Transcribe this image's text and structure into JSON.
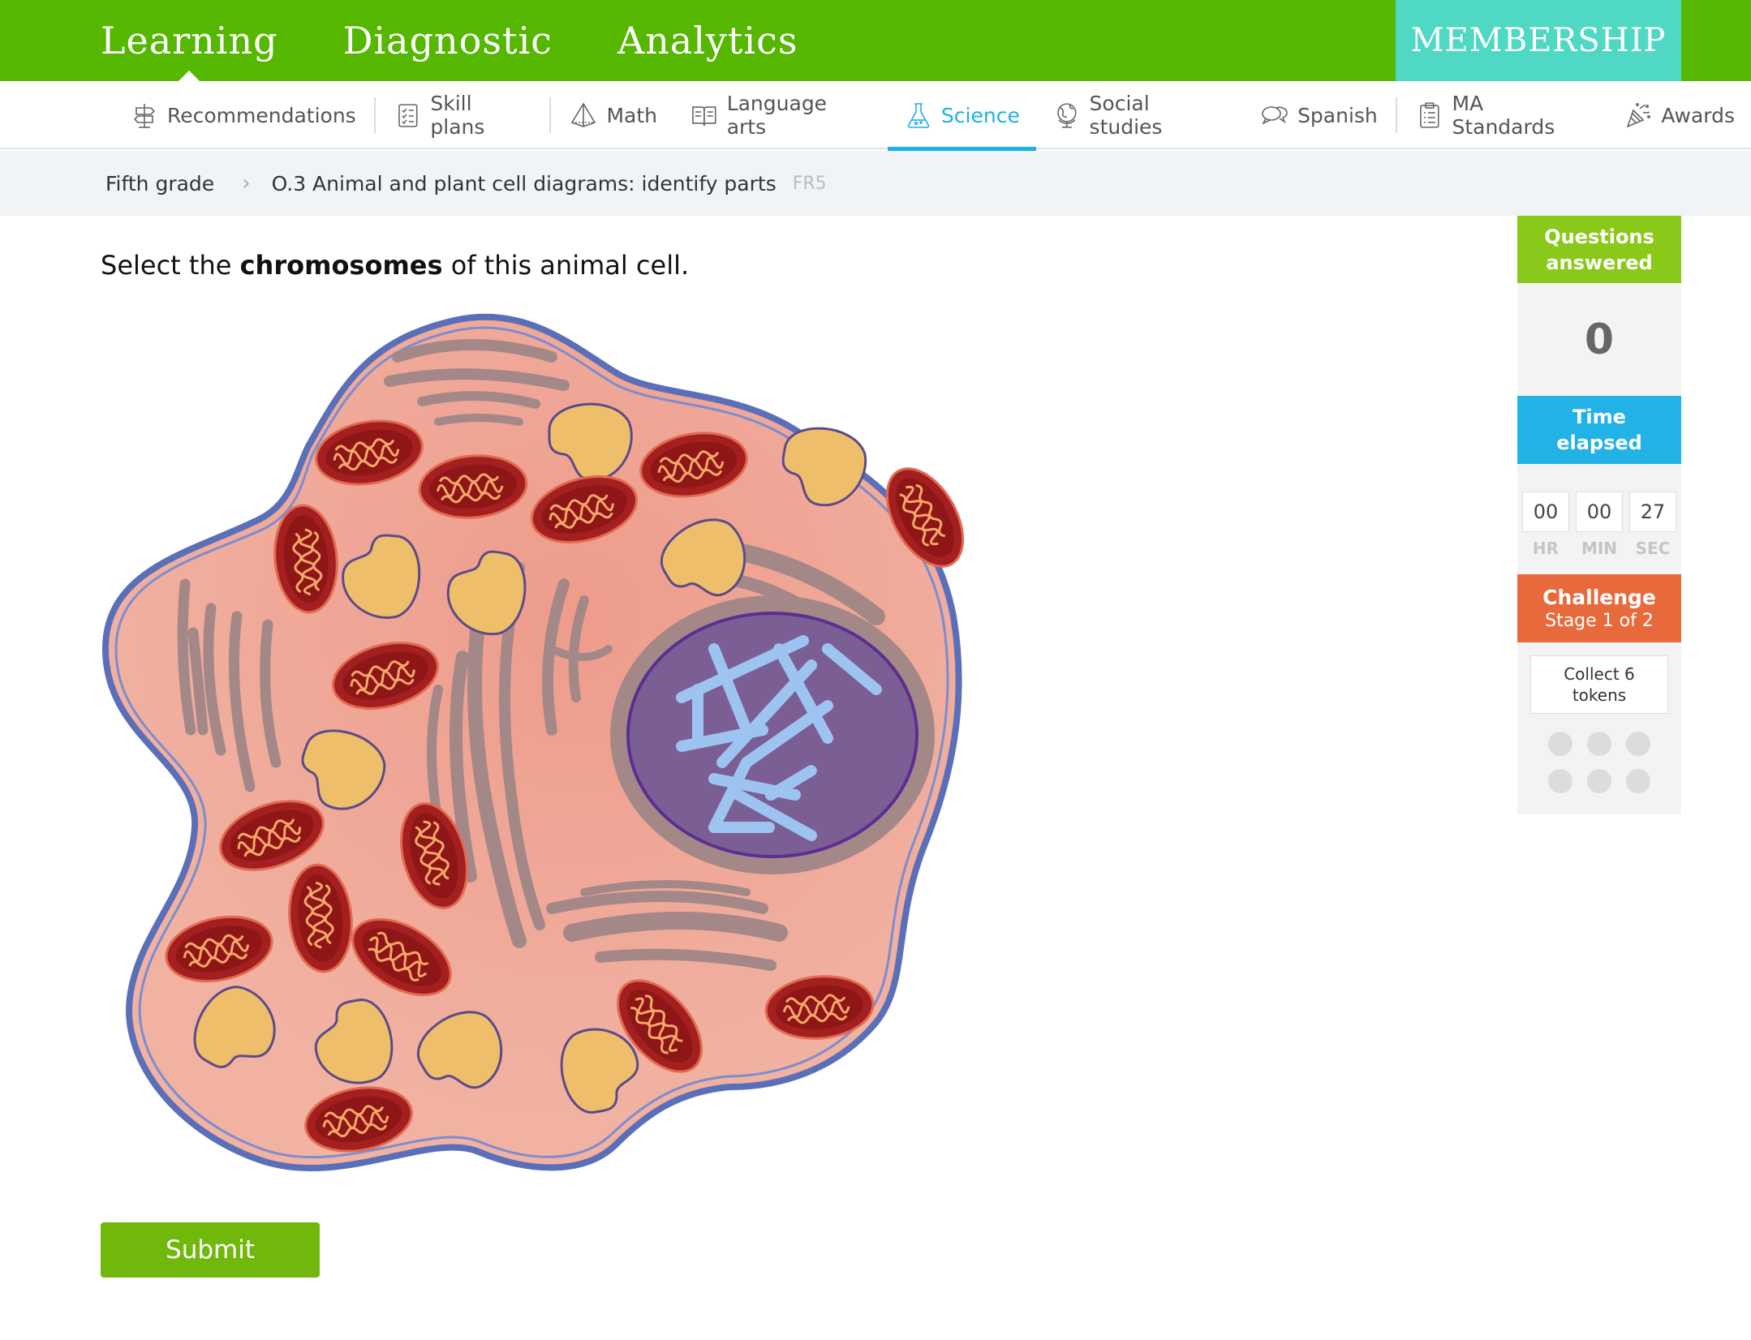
{
  "topnav": {
    "items": [
      {
        "label": "Learning",
        "active": true
      },
      {
        "label": "Diagnostic",
        "active": false
      },
      {
        "label": "Analytics",
        "active": false
      }
    ],
    "membership_label": "MEMBERSHIP"
  },
  "subnav": {
    "items": [
      {
        "label": "Recommendations",
        "icon": "signpost-icon"
      },
      {
        "label": "Skill plans",
        "icon": "checklist-icon"
      },
      {
        "label": "Math",
        "icon": "pyramid-icon"
      },
      {
        "label": "Language arts",
        "icon": "book-icon"
      },
      {
        "label": "Science",
        "icon": "flask-icon",
        "active": true
      },
      {
        "label": "Social studies",
        "icon": "globe-icon"
      },
      {
        "label": "Spanish",
        "icon": "speech-bubbles-icon"
      },
      {
        "label": "MA Standards",
        "icon": "clipboard-icon"
      },
      {
        "label": "Awards",
        "icon": "party-popper-icon"
      }
    ],
    "active_color": "#1cb0e6"
  },
  "breadcrumb": {
    "grade": "Fifth grade",
    "skill": "O.3 Animal and plant cell diagrams: identify parts",
    "code": "FR5"
  },
  "question": {
    "prefix": "Select the ",
    "term": "chromosomes",
    "suffix": " of this animal cell."
  },
  "submit_label": "Submit",
  "sidebar": {
    "questions_answered_label": "Questions answered",
    "questions_answered": "0",
    "time_elapsed_label": "Time elapsed",
    "time": {
      "hr": "00",
      "min": "00",
      "sec": "27"
    },
    "time_units": {
      "hr": "HR",
      "min": "MIN",
      "sec": "SEC"
    },
    "challenge_label": "Challenge",
    "challenge_stage": "Stage 1 of 2",
    "collect_text": "Collect 6 tokens",
    "tokens_total": 6,
    "tokens_collected": 0
  },
  "colors": {
    "topbar": "#56b700",
    "membership": "#4fd8c3",
    "submit": "#70b80c",
    "questions_header": "#8ac81a",
    "time_header": "#22b2e6",
    "challenge_header": "#e86a3c"
  }
}
